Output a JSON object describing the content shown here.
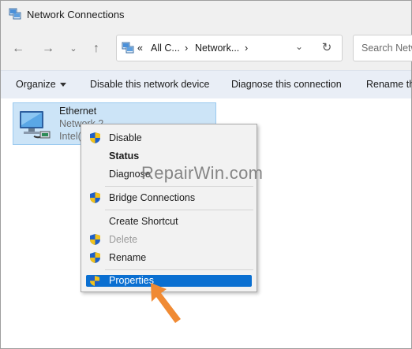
{
  "window": {
    "title": "Network Connections"
  },
  "nav": {
    "address_segments": [
      "«",
      "All C...",
      "›",
      "Network...",
      "›"
    ],
    "search_placeholder": "Search Netw"
  },
  "commands": {
    "organize": "Organize",
    "disable": "Disable this network device",
    "diagnose": "Diagnose this connection",
    "rename": "Rename th"
  },
  "connection": {
    "name": "Ethernet",
    "network": "Network 2",
    "adapter": "Intel("
  },
  "context_menu": {
    "items": [
      {
        "label": "Disable",
        "shield": true
      },
      {
        "label": "Status",
        "bold": true
      },
      {
        "label": "Diagnose"
      },
      {
        "label": "Bridge Connections",
        "shield": true
      },
      {
        "label": "Create Shortcut"
      },
      {
        "label": "Delete",
        "shield": true,
        "disabled": true
      },
      {
        "label": "Rename",
        "shield": true
      },
      {
        "label": "Properties",
        "shield": true,
        "highlighted": true
      }
    ]
  },
  "watermark": "RepairWin.com",
  "colors": {
    "selection": "#cce4f7",
    "menu_highlight": "#0a6fd1",
    "arrow": "#f08a33",
    "shield_blue": "#1e5fc8",
    "shield_yellow": "#f2c21b"
  }
}
